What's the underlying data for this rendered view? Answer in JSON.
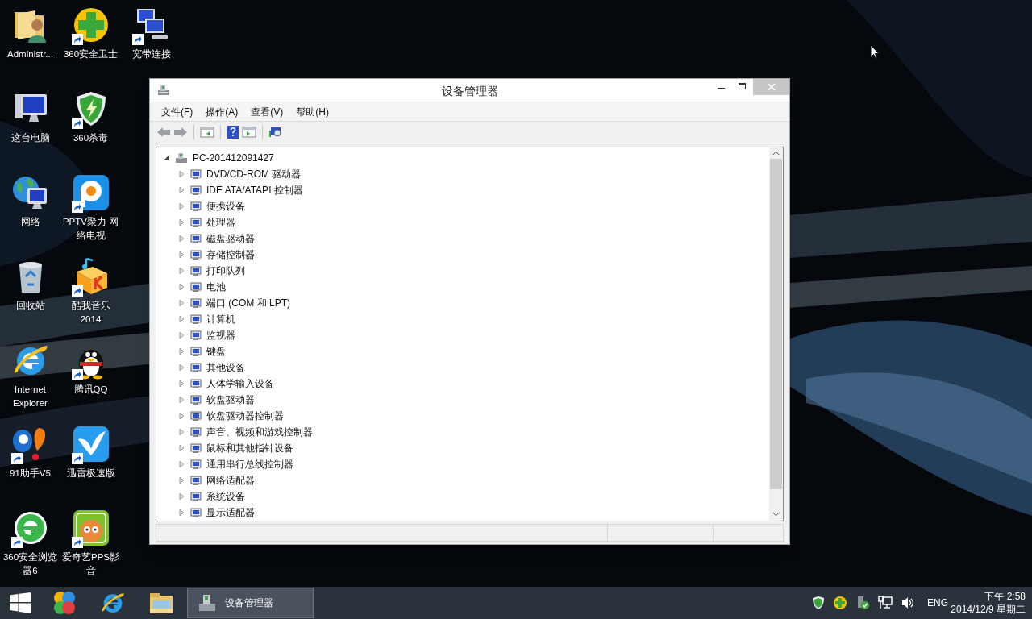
{
  "desktop_icons": [
    {
      "label": "Administr...",
      "kind": "user-folder",
      "shortcut": false
    },
    {
      "label": "360安全卫士",
      "kind": "plus-ball",
      "shortcut": true
    },
    {
      "label": "宽带连接",
      "kind": "network-pcs",
      "shortcut": true
    },
    {
      "label": "这台电脑",
      "kind": "computer",
      "shortcut": false
    },
    {
      "label": "360杀毒",
      "kind": "shield",
      "shortcut": true
    },
    {
      "label": "网络",
      "kind": "globe",
      "shortcut": false
    },
    {
      "label": "PPTV聚力 网络电视",
      "kind": "pptv",
      "shortcut": true
    },
    {
      "label": "回收站",
      "kind": "bin",
      "shortcut": false
    },
    {
      "label": "酷我音乐2014",
      "kind": "music-box",
      "shortcut": true
    },
    {
      "label": "Internet Explorer",
      "kind": "ie",
      "shortcut": false
    },
    {
      "label": "腾讯QQ",
      "kind": "penguin",
      "shortcut": true
    },
    {
      "label": "91助手V5",
      "kind": "bubbles",
      "shortcut": true
    },
    {
      "label": "迅雷极速版",
      "kind": "bird",
      "shortcut": true
    },
    {
      "label": "360安全浏览器6",
      "kind": "green-e",
      "shortcut": true
    },
    {
      "label": "爱奇艺PPS影音",
      "kind": "mascot",
      "shortcut": true
    }
  ],
  "window": {
    "title": "设备管理器",
    "menu": [
      "文件(F)",
      "操作(A)",
      "查看(V)",
      "帮助(H)"
    ],
    "tree": {
      "label": "PC-201412091427",
      "expanded": true,
      "children": [
        {
          "label": "DVD/CD-ROM 驱动器",
          "expanded": false
        },
        {
          "label": "IDE ATA/ATAPI 控制器",
          "expanded": false
        },
        {
          "label": "便携设备",
          "expanded": false
        },
        {
          "label": "处理器",
          "expanded": false
        },
        {
          "label": "磁盘驱动器",
          "expanded": false
        },
        {
          "label": "存储控制器",
          "expanded": false
        },
        {
          "label": "打印队列",
          "expanded": false
        },
        {
          "label": "电池",
          "expanded": false
        },
        {
          "label": "端口 (COM 和 LPT)",
          "expanded": false
        },
        {
          "label": "计算机",
          "expanded": false
        },
        {
          "label": "监视器",
          "expanded": false
        },
        {
          "label": "键盘",
          "expanded": false
        },
        {
          "label": "其他设备",
          "expanded": false
        },
        {
          "label": "人体学输入设备",
          "expanded": false
        },
        {
          "label": "软盘驱动器",
          "expanded": false
        },
        {
          "label": "软盘驱动器控制器",
          "expanded": false
        },
        {
          "label": "声音、视频和游戏控制器",
          "expanded": false
        },
        {
          "label": "鼠标和其他指针设备",
          "expanded": false
        },
        {
          "label": "通用串行总线控制器",
          "expanded": false
        },
        {
          "label": "网络适配器",
          "expanded": false
        },
        {
          "label": "系统设备",
          "expanded": false
        },
        {
          "label": "显示适配器",
          "expanded": false
        }
      ]
    }
  },
  "taskbar": {
    "tasks": [
      {
        "label": "设备管理器",
        "selected": true
      }
    ],
    "input_language": "ENG",
    "time": "下午 2:58",
    "date": "2014/12/9 星期二"
  }
}
